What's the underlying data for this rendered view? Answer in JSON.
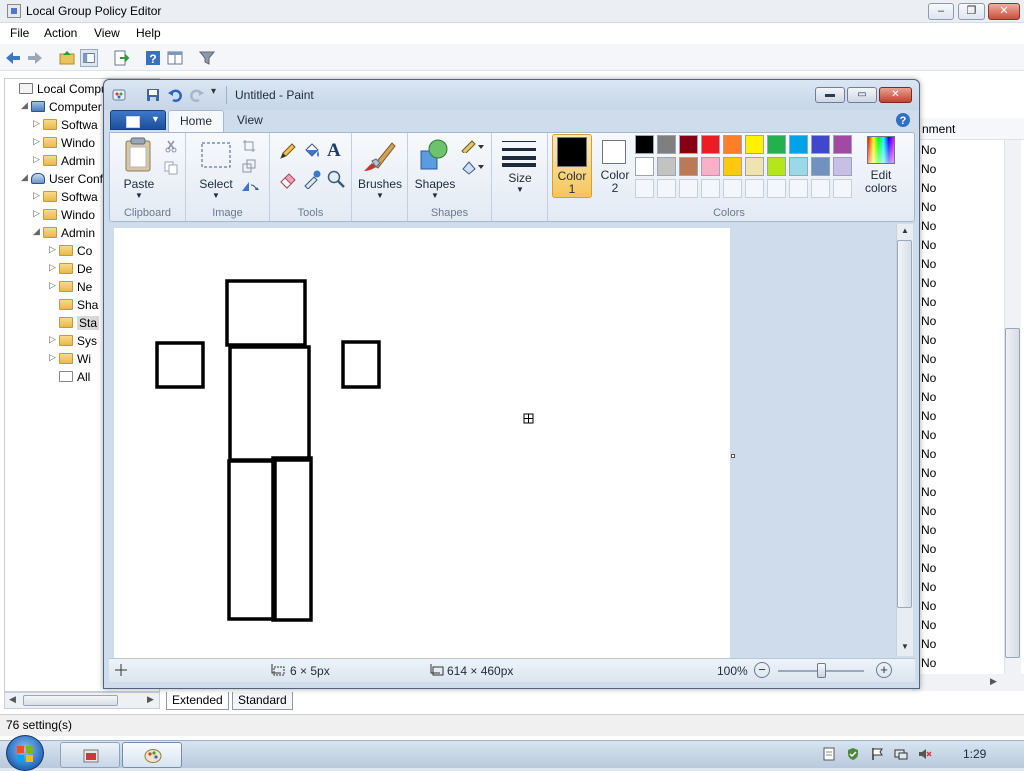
{
  "gp": {
    "title": "Local Group Policy Editor",
    "menu": [
      "File",
      "Action",
      "View",
      "Help"
    ],
    "tree": [
      {
        "label": "Local Compu",
        "level": 0,
        "arrow": "",
        "icon": "policy"
      },
      {
        "label": "Computer",
        "level": 1,
        "arrow": "◢",
        "icon": "computer"
      },
      {
        "label": "Softwa",
        "level": 2,
        "arrow": "▷",
        "icon": "folder"
      },
      {
        "label": "Windo",
        "level": 2,
        "arrow": "▷",
        "icon": "folder"
      },
      {
        "label": "Admin",
        "level": 2,
        "arrow": "▷",
        "icon": "folder"
      },
      {
        "label": "User Conf",
        "level": 1,
        "arrow": "◢",
        "icon": "user"
      },
      {
        "label": "Softwa",
        "level": 2,
        "arrow": "▷",
        "icon": "folder"
      },
      {
        "label": "Windo",
        "level": 2,
        "arrow": "▷",
        "icon": "folder"
      },
      {
        "label": "Admin",
        "level": 2,
        "arrow": "◢",
        "icon": "folder"
      },
      {
        "label": "Co",
        "level": 3,
        "arrow": "▷",
        "icon": "folder"
      },
      {
        "label": "De",
        "level": 3,
        "arrow": "▷",
        "icon": "folder"
      },
      {
        "label": "Ne",
        "level": 3,
        "arrow": "▷",
        "icon": "folder"
      },
      {
        "label": "Sha",
        "level": 3,
        "arrow": "",
        "icon": "folder"
      },
      {
        "label": "Sta",
        "level": 3,
        "arrow": "",
        "icon": "folder",
        "selected": true
      },
      {
        "label": "Sys",
        "level": 3,
        "arrow": "▷",
        "icon": "folder"
      },
      {
        "label": "Wi",
        "level": 3,
        "arrow": "▷",
        "icon": "folder"
      },
      {
        "label": "All",
        "level": 3,
        "arrow": "",
        "icon": "settings"
      }
    ],
    "column_header": "nment",
    "column_values": [
      "No",
      "No",
      "No",
      "No",
      "No",
      "No",
      "No",
      "No",
      "No",
      "No",
      "No",
      "No",
      "No",
      "No",
      "No",
      "No",
      "No",
      "No",
      "No",
      "No",
      "No",
      "No",
      "No",
      "No",
      "No",
      "No",
      "No",
      "No"
    ],
    "tabs": [
      "Extended",
      "Standard"
    ],
    "status": "76 setting(s)"
  },
  "paint": {
    "title": "Untitled - Paint",
    "tabs": [
      "Home",
      "View"
    ],
    "groups": {
      "clipboard": "Clipboard",
      "image": "Image",
      "tools": "Tools",
      "shapes": "Shapes",
      "colors": "Colors"
    },
    "buttons": {
      "paste": "Paste",
      "select": "Select",
      "brushes": "Brushes",
      "shapes": "Shapes",
      "size": "Size",
      "color1": "Color\n1",
      "color2": "Color\n2",
      "edit_colors": "Edit\ncolors"
    },
    "palette_row1": [
      "#000000",
      "#7f7f7f",
      "#880015",
      "#ed1c24",
      "#ff7f27",
      "#fff200",
      "#22b14c",
      "#00a2e8",
      "#3f48cc",
      "#a349a4"
    ],
    "palette_row2": [
      "#ffffff",
      "#c3c3c3",
      "#b97a57",
      "#ffaec9",
      "#ffc90e",
      "#efe4b0",
      "#b5e61d",
      "#99d9ea",
      "#7092be",
      "#c8bfe7"
    ],
    "color1": "#000000",
    "color2": "#ffffff",
    "status": {
      "selection_size": "6 × 5px",
      "canvas_size": "614 × 460px",
      "zoom": "100%"
    }
  },
  "taskbar": {
    "clock": "1:29"
  }
}
